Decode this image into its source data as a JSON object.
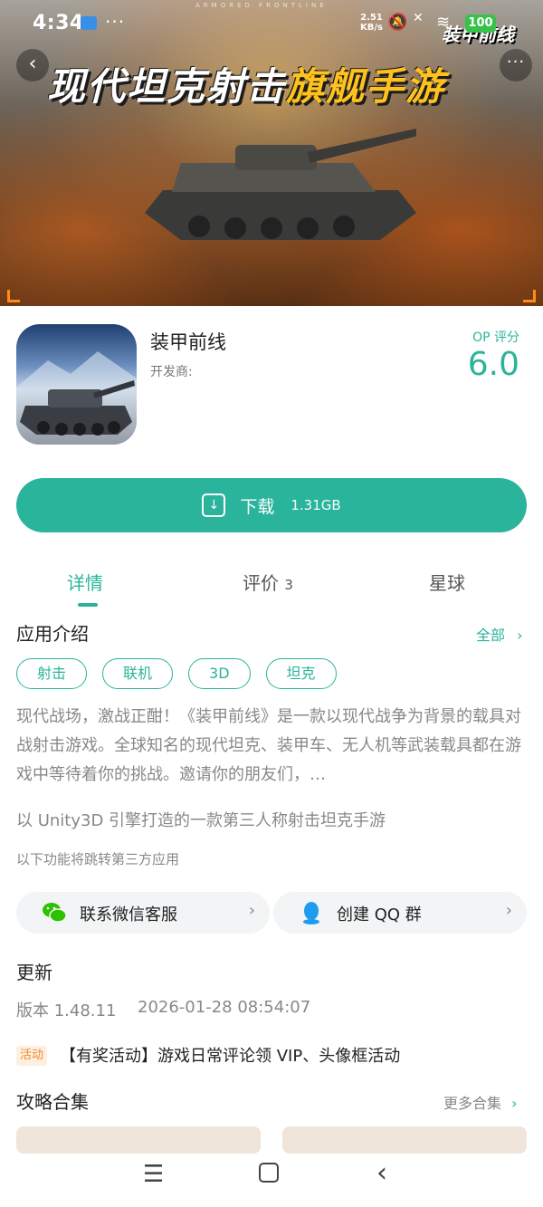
{
  "status_bar": {
    "time": "4:34",
    "more_dots": "···",
    "net_speed_value": "2.51",
    "net_speed_unit": "KB/s",
    "battery": "100"
  },
  "hero": {
    "title_main": "现代坦克射击",
    "title_highlight": "旗舰手游",
    "logo": "装甲前线",
    "tagline": "ARMORED FRONTLINE",
    "back_icon": "‹",
    "more_icon": "···"
  },
  "app": {
    "name": "装甲前线",
    "developer_label": "开发商:",
    "rating_label": "OP 评分",
    "rating_value": "6.0"
  },
  "download": {
    "label": "下载",
    "size": "1.31GB",
    "icon": "↓"
  },
  "tabs": [
    {
      "label": "详情",
      "count": ""
    },
    {
      "label": "评价",
      "count": "3"
    },
    {
      "label": "星球",
      "count": ""
    }
  ],
  "intro": {
    "title": "应用介绍",
    "all_label": "全部",
    "tags": [
      "射击",
      "联机",
      "3D",
      "坦克"
    ],
    "description": "现代战场，激战正酣！《装甲前线》是一款以现代战争为背景的载具对战射击游戏。全球知名的现代坦克、装甲车、无人机等武装载具都在游戏中等待着你的挑战。邀请你的朋友们，…",
    "subtitle": "以 Unity3D 引擎打造的一款第三人称射击坦克手游",
    "third_party_note": "以下功能将跳转第三方应用"
  },
  "services": [
    {
      "label": "联系微信客服",
      "icon": "wechat-icon"
    },
    {
      "label": "创建 QQ 群",
      "icon": "qq-icon"
    }
  ],
  "update": {
    "title": "更新",
    "version": "版本 1.48.11",
    "date": "2026-01-28 08:54:07"
  },
  "activity": {
    "badge": "活动",
    "text": "【有奖活动】游戏日常评论领 VIP、头像框活动"
  },
  "guides": {
    "title": "攻略合集",
    "more_label": "更多合集"
  },
  "colors": {
    "accent": "#2ab49b",
    "activity": "#f08a24"
  }
}
